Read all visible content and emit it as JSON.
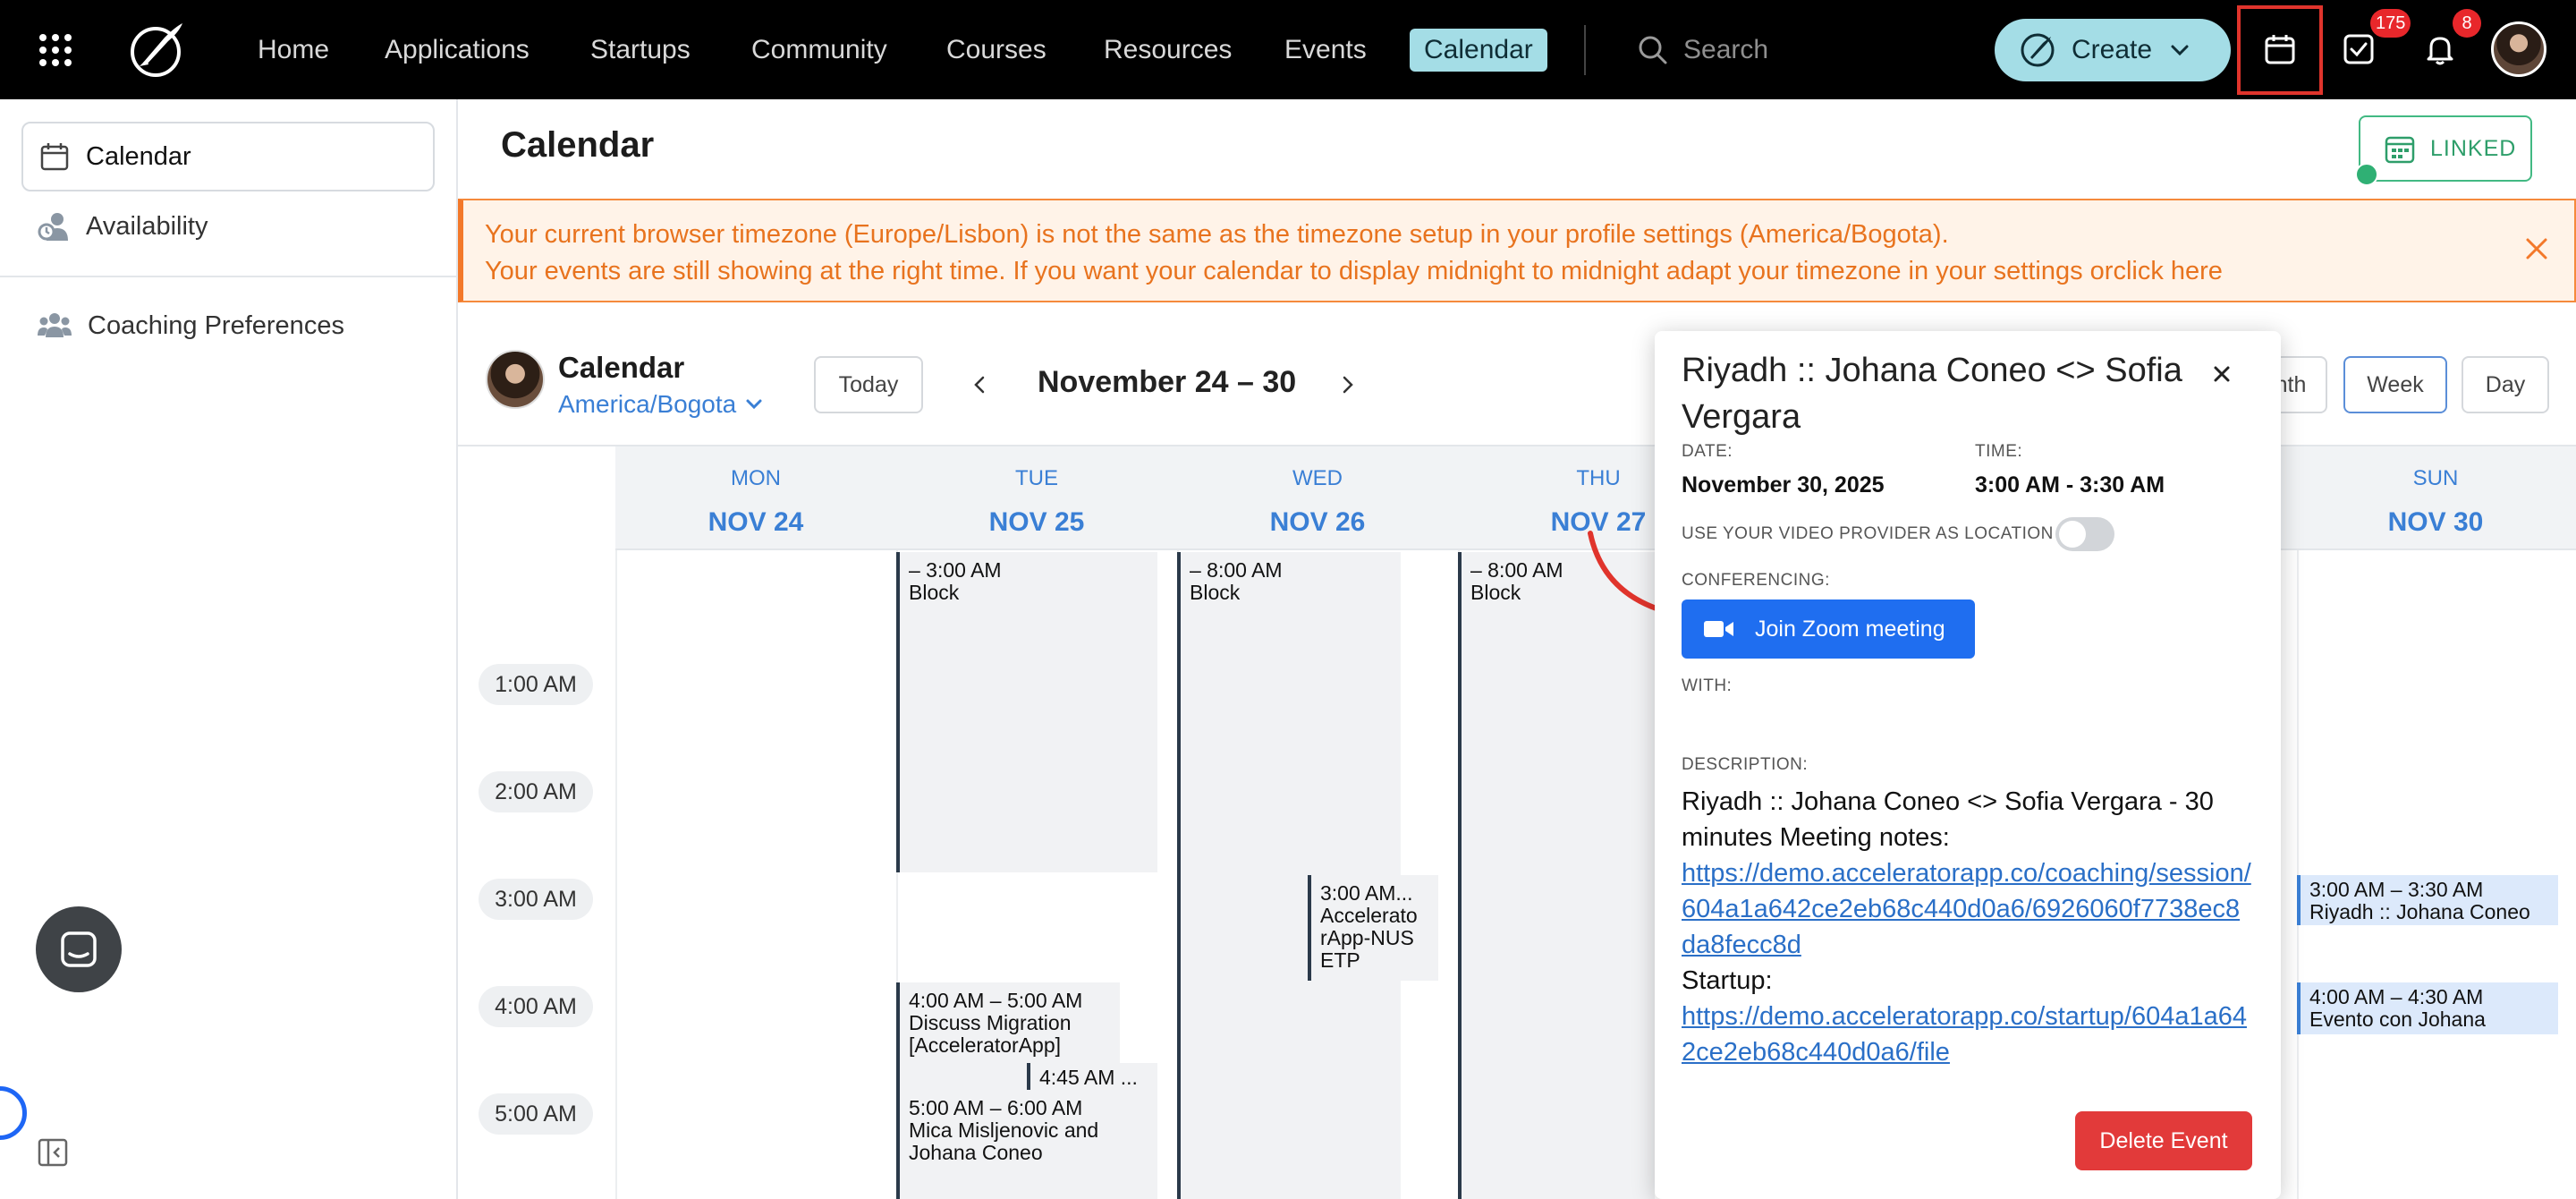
{
  "nav": {
    "items": [
      {
        "label": "Home"
      },
      {
        "label": "Applications"
      },
      {
        "label": "Startups"
      },
      {
        "label": "Community"
      },
      {
        "label": "Courses"
      },
      {
        "label": "Resources"
      },
      {
        "label": "Events"
      },
      {
        "label": "Calendar"
      }
    ],
    "search_label": "Search",
    "create_label": "Create",
    "tasks_badge": "175",
    "notifications_badge": "8"
  },
  "sidebar": {
    "items": [
      {
        "label": "Calendar",
        "icon": "calendar-icon"
      },
      {
        "label": "Availability",
        "icon": "availability-icon"
      },
      {
        "label": "Coaching Preferences",
        "icon": "people-icon"
      }
    ]
  },
  "page": {
    "title": "Calendar",
    "linked_label": "LINKED"
  },
  "warning": {
    "line1": "Your current browser timezone (Europe/Lisbon) is not the same as the timezone setup in your profile settings (America/Bogota).",
    "line2": "Your events are still showing at the right time. If you want your calendar to display midnight to midnight adapt your timezone in your settings orclick here"
  },
  "calendar": {
    "name": "Calendar",
    "timezone": "America/Bogota",
    "today_label": "Today",
    "range": "November 24 – 30",
    "views": {
      "month": "Month",
      "month_visible": "nth",
      "week": "Week",
      "day": "Day"
    },
    "days": [
      {
        "dow": "MON",
        "date": "NOV 24"
      },
      {
        "dow": "TUE",
        "date": "NOV 25"
      },
      {
        "dow": "WED",
        "date": "NOV 26"
      },
      {
        "dow": "THU",
        "date": "NOV 27"
      },
      {
        "dow": "SUN",
        "date": "NOV 30"
      }
    ],
    "times": [
      "1:00 AM",
      "2:00 AM",
      "3:00 AM",
      "4:00 AM",
      "5:00 AM"
    ],
    "events": [
      {
        "time": "– 3:00 AM",
        "title": "Block"
      },
      {
        "time": "– 8:00 AM",
        "title": "Block"
      },
      {
        "time": "– 8:00 AM",
        "title": "Block"
      },
      {
        "time": "3:00 AM...",
        "title": "Accelerato rApp-NUS ETP"
      },
      {
        "time": "4:00 AM – 5:00 AM",
        "title": "Discuss Migration [AcceleratorApp]"
      },
      {
        "time": "4:45 AM ...",
        "title": ""
      },
      {
        "time": "5:00 AM – 6:00 AM",
        "title": "Mica Misljenovic and Johana Coneo"
      },
      {
        "time": "3:00 AM – 3:30 AM",
        "title": "Riyadh :: Johana Coneo"
      },
      {
        "time": "4:00 AM – 4:30 AM",
        "title": "Evento con Johana"
      }
    ]
  },
  "popover": {
    "title": "Riyadh :: Johana Coneo <> Sofia Vergara",
    "date_label": "DATE:",
    "date_value": "November 30, 2025",
    "time_label": "TIME:",
    "time_value": "3:00 AM - 3:30 AM",
    "video_label": "USE YOUR VIDEO PROVIDER AS LOCATION",
    "video_enabled": false,
    "conferencing_label": "CONFERENCING:",
    "zoom_label": "Join Zoom meeting",
    "with_label": "WITH:",
    "description_label": "DESCRIPTION:",
    "description_text": "Riyadh :: Johana Coneo <> Sofia Vergara - 30 minutes Meeting notes:",
    "session_link": "https://demo.acceleratorapp.co/coaching/session/604a1a642ce2eb68c440d0a6/6926060f7738ec8da8fecc8d",
    "startup_label": "Startup:",
    "startup_link": "https://demo.acceleratorapp.co/startup/604a1a642ce2eb68c440d0a6/file",
    "delete_label": "Delete Event"
  },
  "colors": {
    "nav_bg": "#000000",
    "accent": "#a4dde6",
    "link_blue": "#3a7fd5",
    "warning_orange": "#f3782a",
    "zoom_blue": "#1f6ef0",
    "danger": "#e23a3a",
    "linked_green": "#42b983"
  }
}
